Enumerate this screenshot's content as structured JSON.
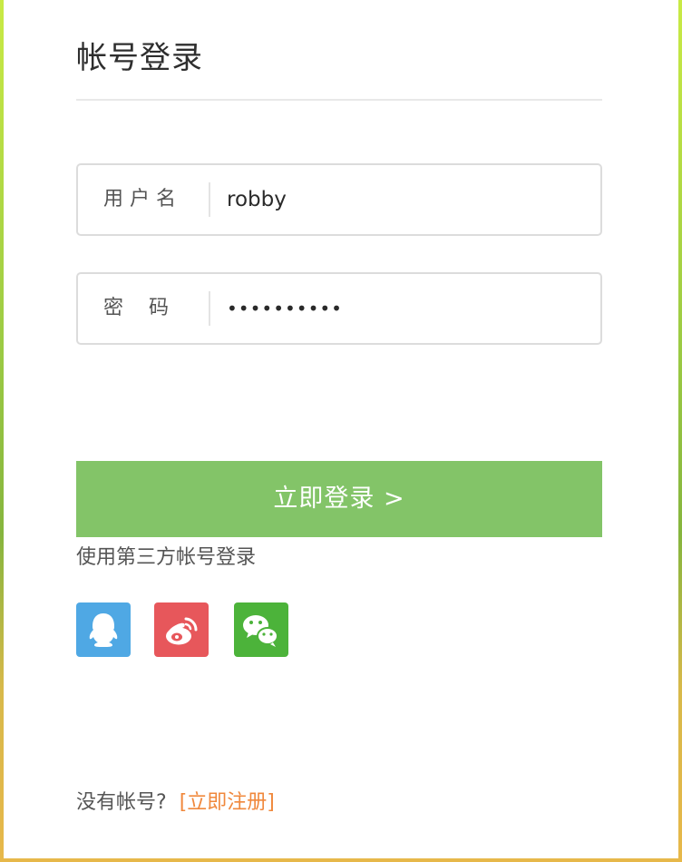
{
  "title": "帐号登录",
  "username": {
    "label": "用 户 名",
    "value": "robby"
  },
  "password": {
    "label": "密    码",
    "value_masked": "••••••••••"
  },
  "login_button": {
    "label": "立即登录 >"
  },
  "third_party": {
    "label": "使用第三方帐号登录",
    "providers": [
      {
        "name": "qq",
        "icon": "qq-icon",
        "color": "#4fa8e4"
      },
      {
        "name": "weibo",
        "icon": "weibo-icon",
        "color": "#e7575b"
      },
      {
        "name": "wechat",
        "icon": "wechat-icon",
        "color": "#4cb33a"
      }
    ]
  },
  "register": {
    "prompt": "没有帐号?",
    "link": "[立即注册]"
  },
  "colors": {
    "button": "#83c468",
    "link": "#f0883c"
  }
}
